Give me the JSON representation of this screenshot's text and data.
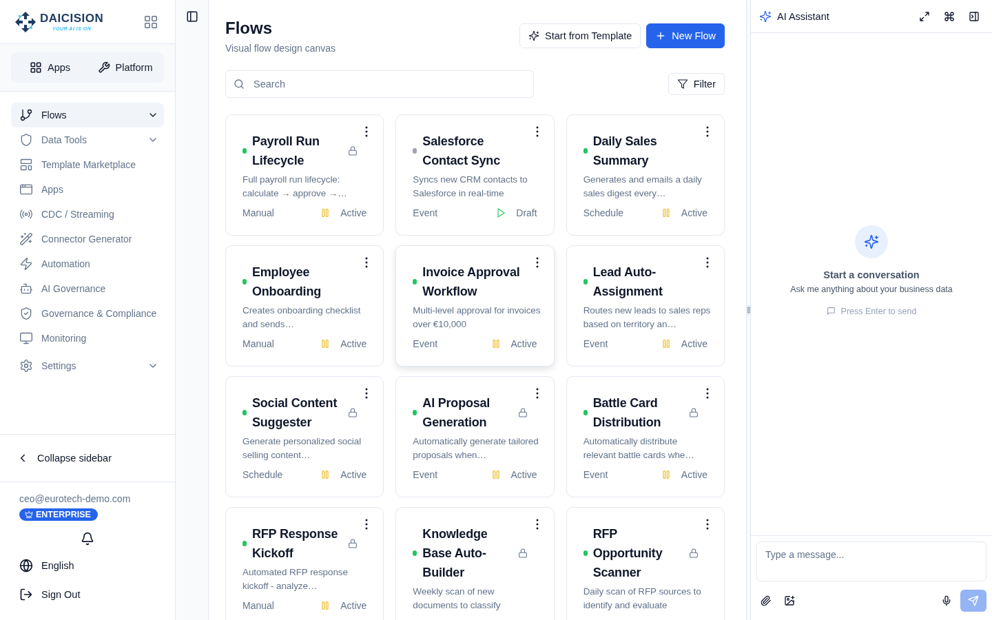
{
  "sidebar": {
    "brand": {
      "name": "DAICISION",
      "tagline": "YOUR AI IS ON"
    },
    "switcher": [
      {
        "label": "Apps",
        "selected": false
      },
      {
        "label": "Platform",
        "selected": false
      }
    ],
    "nav": [
      {
        "label": "Flows",
        "selected": true,
        "expandable": true
      },
      {
        "label": "Data Tools",
        "selected": false,
        "expandable": true
      },
      {
        "label": "Template Marketplace",
        "selected": false,
        "expandable": false
      },
      {
        "label": "Apps",
        "selected": false,
        "expandable": false
      },
      {
        "label": "CDC / Streaming",
        "selected": false,
        "expandable": false
      },
      {
        "label": "Connector Generator",
        "selected": false,
        "expandable": false
      },
      {
        "label": "Automation",
        "selected": false,
        "expandable": false
      },
      {
        "label": "AI Governance",
        "selected": false,
        "expandable": false
      },
      {
        "label": "Governance & Compliance",
        "selected": false,
        "expandable": false
      },
      {
        "label": "Monitoring",
        "selected": false,
        "expandable": false
      },
      {
        "label": "Settings",
        "selected": false,
        "expandable": true
      }
    ],
    "collapse": "Collapse sidebar",
    "account": {
      "email": "ceo@eurotech-demo.com",
      "plan": "ENTERPRISE"
    },
    "language": "English",
    "sign_out": "Sign Out"
  },
  "header": {
    "title": "Flows",
    "subtitle": "Visual flow design canvas",
    "buttons": [
      {
        "label": "Start from Template",
        "kind": "secondary"
      },
      {
        "label": "New Flow",
        "kind": "primary"
      }
    ]
  },
  "search": {
    "placeholder": "Search"
  },
  "filter": "Filter",
  "flows": [
    {
      "name": "Payroll Run Lifecycle",
      "color": "#22c55e",
      "locked": true,
      "highlighted": false,
      "description": "Full payroll run lifecycle: calculate → approve →…",
      "trigger": "Manual",
      "status": "Active",
      "running": true
    },
    {
      "name": "Salesforce Contact Sync",
      "color": "#9ca3af",
      "locked": false,
      "highlighted": false,
      "description": "Syncs new CRM contacts to Salesforce in real-time",
      "trigger": "Event",
      "status": "Draft",
      "running": false
    },
    {
      "name": "Daily Sales Summary",
      "color": "#22c55e",
      "locked": false,
      "highlighted": false,
      "description": "Generates and emails a daily sales digest every…",
      "trigger": "Schedule",
      "status": "Active",
      "running": true
    },
    {
      "name": "Employee Onboarding",
      "color": "#22c55e",
      "locked": false,
      "highlighted": false,
      "description": "Creates onboarding checklist and sends…",
      "trigger": "Manual",
      "status": "Active",
      "running": true
    },
    {
      "name": "Invoice Approval Workflow",
      "color": "#22c55e",
      "locked": false,
      "highlighted": true,
      "description": "Multi-level approval for invoices over €10,000",
      "trigger": "Event",
      "status": "Active",
      "running": true
    },
    {
      "name": "Lead Auto-Assignment",
      "color": "#22c55e",
      "locked": false,
      "highlighted": false,
      "description": "Routes new leads to sales reps based on territory an…",
      "trigger": "Event",
      "status": "Active",
      "running": true
    },
    {
      "name": "Social Content Suggester",
      "color": "#22c55e",
      "locked": true,
      "highlighted": false,
      "description": "Generate personalized social selling content…",
      "trigger": "Schedule",
      "status": "Active",
      "running": true
    },
    {
      "name": "AI Proposal Generation",
      "color": "#22c55e",
      "locked": true,
      "highlighted": false,
      "description": "Automatically generate tailored proposals when…",
      "trigger": "Event",
      "status": "Active",
      "running": true
    },
    {
      "name": "Battle Card Distribution",
      "color": "#22c55e",
      "locked": true,
      "highlighted": false,
      "description": "Automatically distribute relevant battle cards whe…",
      "trigger": "Event",
      "status": "Active",
      "running": true
    },
    {
      "name": "RFP Response Kickoff",
      "color": "#22c55e",
      "locked": true,
      "highlighted": false,
      "description": "Automated RFP response kickoff - analyze…",
      "trigger": "Manual",
      "status": "Active",
      "running": true
    },
    {
      "name": "Knowledge Base Auto-Builder",
      "color": "#22c55e",
      "locked": true,
      "highlighted": false,
      "description": "Weekly scan of new documents to classify"
    },
    {
      "name": "RFP Opportunity Scanner",
      "color": "#22c55e",
      "locked": true,
      "highlighted": false,
      "description": "Daily scan of RFP sources to identify and evaluate"
    }
  ],
  "assistant": {
    "title": "AI Assistant",
    "empty": {
      "title": "Start a conversation",
      "subtitle": "Ask me anything about your business data",
      "hint": "Press Enter to send"
    },
    "input": {
      "placeholder": "Type a message..."
    },
    "send_disabled": true
  }
}
